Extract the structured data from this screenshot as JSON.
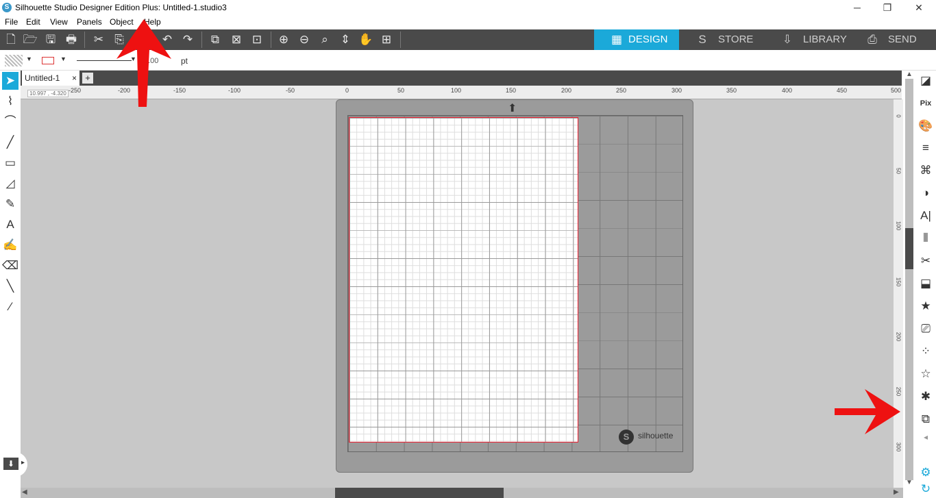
{
  "window": {
    "title": "Silhouette Studio Designer Edition Plus: Untitled-1.studio3",
    "logo_glyph": "S",
    "minimize_glyph": "─",
    "maximize_glyph": "❐",
    "close_glyph": "✕"
  },
  "menu": [
    "File",
    "Edit",
    "View",
    "Panels",
    "Object",
    "Help"
  ],
  "toolbar": {
    "icons": [
      "new-file-icon",
      "open-folder-icon",
      "save-icon",
      "print-icon",
      "cut-icon",
      "copy-icon",
      "paste-icon",
      "undo-icon",
      "redo-icon",
      "group-icon",
      "ungroup-icon",
      "select-all-icon",
      "zoom-in-icon",
      "zoom-out-icon",
      "zoom-fit-icon",
      "pan-move-icon",
      "hand-pan-icon",
      "fit-page-icon"
    ],
    "glyphs": [
      "🗋",
      "🗁",
      "🖫",
      "🖶",
      "✂",
      "⎘",
      "📋",
      "↶",
      "↷",
      "⧉",
      "⊠",
      "⊡",
      "⊕",
      "⊖",
      "⌕",
      "⇕",
      "✋",
      "⊞"
    ]
  },
  "nav": {
    "design": "DESIGN",
    "store": "STORE",
    "library": "LIBRARY",
    "send": "SEND",
    "design_icon": "▦",
    "store_icon": "S",
    "library_icon": "⇩",
    "send_icon": "⎙"
  },
  "properties": {
    "line_width": "0.00",
    "line_unit": "pt",
    "caret": "▼"
  },
  "tools": {
    "names": [
      "select-tool-icon",
      "point-edit-icon",
      "curve-icon",
      "line-tool-icon",
      "rectangle-tool-icon",
      "polygon-tool-icon",
      "pencil-tool-icon",
      "text-tool-icon",
      "sketch-tool-icon",
      "eraser-tool-icon",
      "knife-tool-icon",
      "eyedropper-tool-icon"
    ],
    "glyphs": [
      "➤",
      "⌇",
      "⌒",
      "╱",
      "▭",
      "◿",
      "✎",
      "A",
      "✍",
      "⌫",
      "╲",
      "⁄"
    ]
  },
  "document": {
    "tab_label": "Untitled-1",
    "close_glyph": "×",
    "add_glyph": "+"
  },
  "ruler": {
    "coord_readout": "10.997 , -4.320",
    "h_labels": [
      "-250",
      "-200",
      "-150",
      "-100",
      "-50",
      "0",
      "50",
      "100",
      "150",
      "200",
      "250",
      "300",
      "350",
      "400",
      "450",
      "500"
    ],
    "v_labels": [
      "0",
      "50",
      "100",
      "150",
      "200",
      "250",
      "300"
    ]
  },
  "mat": {
    "brand": "silhouette",
    "logo_glyph": "S",
    "feed_arrow": "⬆"
  },
  "right_panel": {
    "names": [
      "page-setup-icon",
      "pixscan-icon",
      "fill-panel-icon",
      "line-style-icon",
      "image-trace-icon",
      "offset-icon",
      "text-style-icon",
      "align-icon",
      "modify-icon",
      "replicate-icon",
      "design-store-icon",
      "library-panel-icon",
      "sketch-panel-icon",
      "rhinestone-icon",
      "star-icon",
      "puzzle-icon",
      "layers-icon",
      "collapse-arrow-icon",
      "settings-gear-icon",
      "refresh-icon"
    ],
    "glyphs": [
      "◪",
      "Pix",
      "🎨",
      "≡",
      "⌘",
      "◑",
      "A|",
      "⫴",
      "✂",
      "⬓",
      "★",
      "⎚",
      "⁘",
      "☆",
      "✱",
      "⧉",
      "◂",
      "⚙",
      "↻"
    ]
  },
  "scroll": {
    "up": "▲",
    "down": "▼",
    "left": "◀",
    "right": "▶"
  },
  "bottom_left": {
    "glyph": "⬇",
    "expand_glyph": "▸"
  },
  "annotation_color": "#ee1111"
}
